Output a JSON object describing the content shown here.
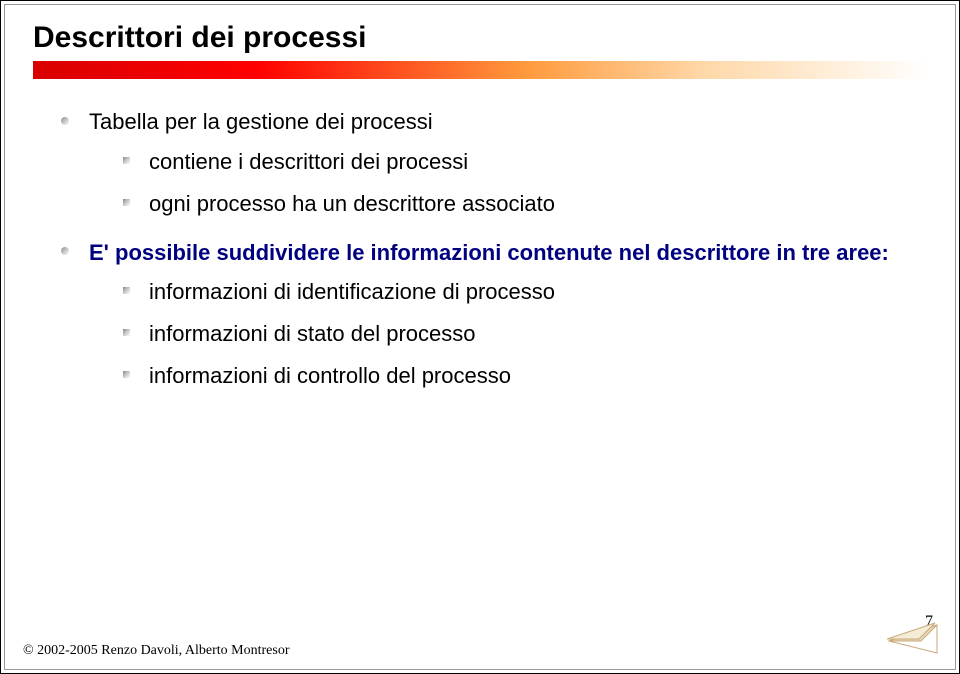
{
  "title": "Descrittori dei processi",
  "bullets": {
    "b1": "Tabella per la gestione dei processi",
    "b1_sub": {
      "s1": "contiene i descrittori dei processi",
      "s2": "ogni processo ha un descrittore associato"
    },
    "b2": "E' possibile suddividere le informazioni contenute nel descrittore in tre aree:",
    "b2_sub": {
      "s1": "informazioni di identificazione di processo",
      "s2": "informazioni di stato del processo",
      "s3": "informazioni di controllo del processo"
    }
  },
  "footer": "© 2002-2005 Renzo Davoli, Alberto Montresor",
  "page": "7"
}
